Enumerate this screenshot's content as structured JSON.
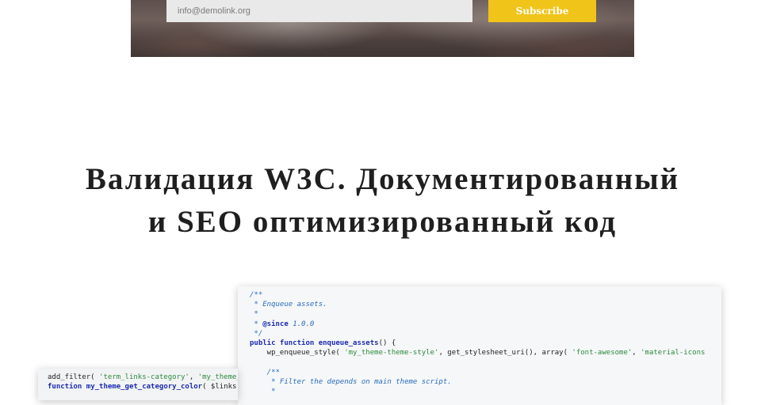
{
  "newsletter": {
    "email_placeholder": "info@demolink.org",
    "subscribe_label": "Subscribe",
    "accent_color": "#f0c419"
  },
  "section": {
    "title_line1": "Валидация W3C. Документированный",
    "title_line2": "и SEO оптимизированный код"
  },
  "code_main": {
    "lines": [
      {
        "parts": [
          {
            "t": "/**",
            "c": "comment"
          }
        ]
      },
      {
        "parts": [
          {
            "t": " * Enqueue assets.",
            "c": "comment"
          }
        ]
      },
      {
        "parts": [
          {
            "t": " *",
            "c": "comment"
          }
        ]
      },
      {
        "parts": [
          {
            "t": " * ",
            "c": "comment"
          },
          {
            "t": "@since",
            "c": "kw"
          },
          {
            "t": " 1.0.0",
            "c": "comment"
          }
        ]
      },
      {
        "parts": [
          {
            "t": " */",
            "c": "comment"
          }
        ]
      },
      {
        "parts": [
          {
            "t": "public function",
            "c": "kw"
          },
          {
            "t": " ",
            "c": "plain"
          },
          {
            "t": "enqueue_assets",
            "c": "kw"
          },
          {
            "t": "() {",
            "c": "plain"
          }
        ]
      },
      {
        "parts": [
          {
            "t": "    wp_enqueue_style( ",
            "c": "plain"
          },
          {
            "t": "'my_theme-theme-style'",
            "c": "str"
          },
          {
            "t": ", get_stylesheet_uri(), array( ",
            "c": "plain"
          },
          {
            "t": "'font-awesome'",
            "c": "str"
          },
          {
            "t": ", ",
            "c": "plain"
          },
          {
            "t": "'material-icons",
            "c": "str"
          }
        ]
      },
      {
        "parts": [
          {
            "t": "",
            "c": "plain"
          }
        ]
      },
      {
        "parts": [
          {
            "t": "    /**",
            "c": "comment"
          }
        ]
      },
      {
        "parts": [
          {
            "t": "     * Filter the depends on main theme script.",
            "c": "comment"
          }
        ]
      },
      {
        "parts": [
          {
            "t": "     *",
            "c": "comment"
          }
        ]
      }
    ]
  },
  "code_secondary": {
    "lines": [
      {
        "parts": [
          {
            "t": "add_filter( ",
            "c": "plain"
          },
          {
            "t": "'term_links-category'",
            "c": "str"
          },
          {
            "t": ", ",
            "c": "plain"
          },
          {
            "t": "'my_theme_get_",
            "c": "str"
          }
        ]
      },
      {
        "parts": [
          {
            "t": "function",
            "c": "kw"
          },
          {
            "t": " ",
            "c": "plain"
          },
          {
            "t": "my_theme_get_category_color",
            "c": "kw"
          },
          {
            "t": "( $links ) {",
            "c": "plain"
          }
        ]
      }
    ]
  }
}
